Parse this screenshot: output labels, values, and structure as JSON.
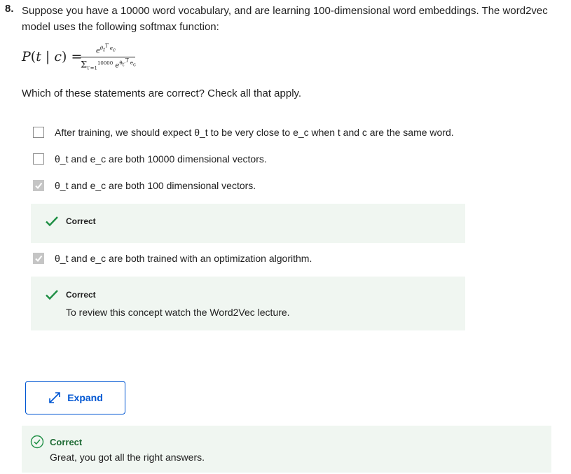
{
  "question": {
    "number": "8.",
    "text": "Suppose you have a 10000 word vocabulary, and are learning 100-dimensional word embeddings. The word2vec model uses the following softmax function:",
    "formula": {
      "lhs": "P(t | c) =",
      "numerator": "e^(θ_t^T e_c)",
      "denominator": "Σ_(t'=1)^10000 e^(θ_t'^T e_c)"
    },
    "instruction": "Which of these statements are correct? Check all that apply."
  },
  "options": [
    {
      "label": "After training, we should expect θ_t to be very close to e_c when t and c are the same word.",
      "checked": false
    },
    {
      "label": "θ_t and e_c are both 10000 dimensional vectors.",
      "checked": false
    },
    {
      "label": "θ_t and e_c are both 100 dimensional vectors.",
      "checked": true
    },
    {
      "label": "θ_t and e_c are both trained with an optimization algorithm.",
      "checked": true
    }
  ],
  "feedback": [
    {
      "title": "Correct",
      "text": ""
    },
    {
      "title": "Correct",
      "text": "To review this concept watch the Word2Vec lecture."
    }
  ],
  "expand_button": {
    "label": "Expand"
  },
  "result": {
    "title": "Correct",
    "text": "Great, you got all the right answers."
  },
  "colors": {
    "accent": "#0056d2",
    "success": "#1f8f45",
    "feedback_bg": "#f0f6f1"
  },
  "icons": [
    "check-icon",
    "expand-arrows-icon",
    "circle-check-icon"
  ]
}
